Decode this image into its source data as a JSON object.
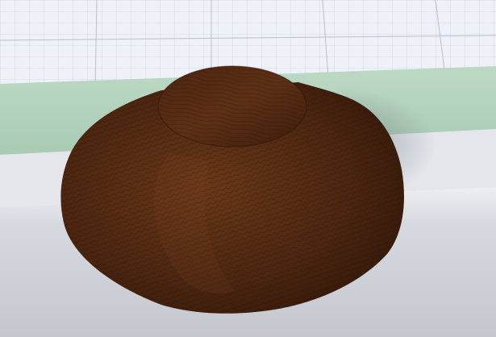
{
  "scene": {
    "object": "wooden-bowl",
    "colors": {
      "grid_background": "#eef1f8",
      "grid_line": "#c7ccd8",
      "green_strip": "#b4d3be",
      "floor": "#c8cbd2",
      "floor_light": "#e6e8ee",
      "wood_dark": "#2e160a",
      "wood_mid": "#5a2e14",
      "wood_light": "#6e3a1a"
    }
  }
}
